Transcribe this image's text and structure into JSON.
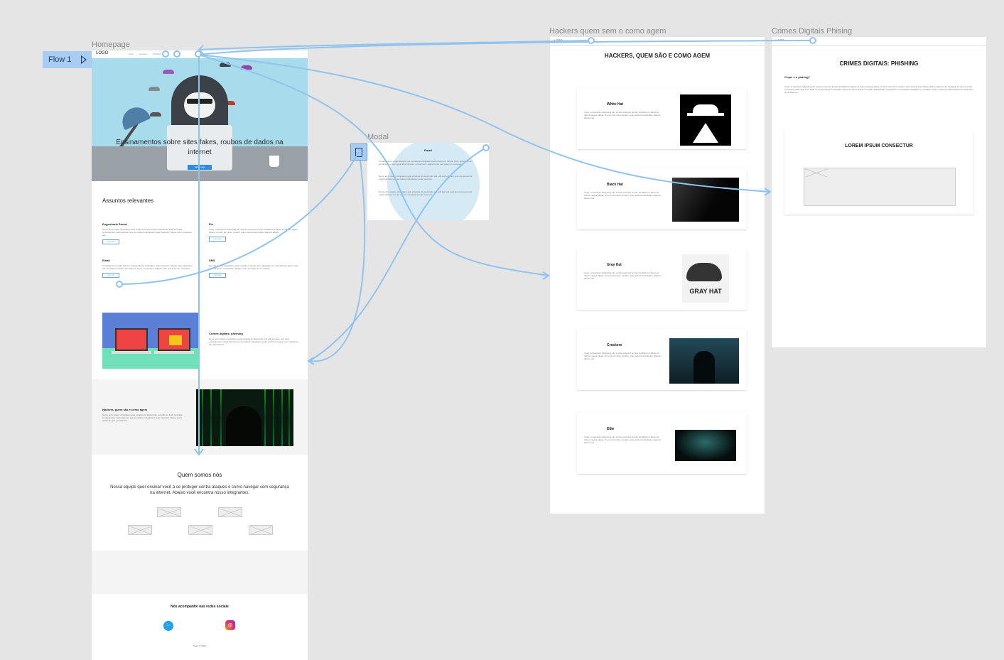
{
  "canvas": {
    "flow_label": "Flow 1",
    "frames": {
      "homepage": "Homepage",
      "modal": "Modal",
      "hackers": "Hackers quem sem o como agem",
      "phishing": "Crimes Digitais Phising"
    }
  },
  "home": {
    "logo": "LOGO",
    "nav": [
      "Início",
      "Hackers",
      "Phishing"
    ],
    "hero_title": "Ensinamentos sobre sites fakes, roubos de dados na internet",
    "hero_button": "Saiba mais",
    "topics_title": "Assuntos relevantes",
    "topics": [
      {
        "title": "Engenharia Social",
        "text": "Nemo enim ipsam voluptatem quia voluptas sit aspernatur aut odit aut fugit, sed quia consequuntur magni dolores eos qui ratione voluptatem sequi nesciunt. Neque porro quisquam est.",
        "button": "Leia mais"
      },
      {
        "title": "Pix",
        "text": "Amet, consectetur adipiscing elit, sed do eiusmod tempor incididunt ut labore et dolore magna aliqua. Ut enim ad minim veniam, quis nostrud exercitation ullamco laboris.",
        "button": "Leia mais"
      },
      {
        "title": "Email",
        "text": "Consequuntur magni dolores eos qui ratione voluptatem sequi nesciunt. Neque porro quisquam est, qui dolorem ipsum quia dolor sit amet, consectetur, adipisci velit, sed quia non numquam.",
        "button": "Leia mais"
      },
      {
        "title": "SMS",
        "text": "Eos qui ratione voluptatem sequi nesciunt. Neque porro quisquam est, qui dolorem ipsum quia dolor sit amet, consectetur, adipisci velit, sed quia non numquam.",
        "button": "Leia mais"
      }
    ],
    "phishing_title": "Crimes digitais: phishing",
    "phishing_text": "Nemo enim ipsam voluptatem quia voluptas sit aspernatur aut odit aut fugit, sed quia consequuntur magni dolores eos qui ratione voluptatem sequi nesciunt. Neque porro quisquam est, qui dolorem.",
    "hackers_title": "Hackers, quem são e como agem",
    "hackers_text": "Nemo enim ipsam voluptatem quia voluptas sit aspernatur aut odit aut fugit, sed quia consequuntur magni dolores eos qui ratione voluptatem sequi nesciunt. Neque porro quisquam est, qui dolorem.",
    "about_title": "Quem somos nós",
    "about_text": "Nossa equipe quer ensinar você a se proteger contra ataques e como navegar com segurança na internet. Abaixo você encontra nosso integrantes.",
    "social_title": "Nós acompanhe nas redes sociais",
    "footer": "Team © 2021"
  },
  "modal": {
    "title": "Email",
    "paragraphs": [
      "Consequuntur magni dolores eos qui ratione voluptatem sequi nesciunt. Neque porro quisquam est, qui dolorem ipsum quia dolor sit amet, consectetur, adipisci velit, sed quia non numquam.",
      "Nemo enim ipsam voluptatem quia voluptas sit aspernatur aut odit aut fugit, sed quia consequuntur magni dolores eos qui ratione voluptatem sequi nesciunt.",
      "Nemo enim ipsam voluptatem quia voluptas sit aspernatur aut odit aut fugit, sed quia consequuntur magni dolores eos qui ratione voluptatem sequi nesciunt."
    ]
  },
  "hackers": {
    "logo": "LOGO",
    "title": "HACKERS, QUEM SÃO E COMO AGEM",
    "cards": [
      {
        "title": "White Hat",
        "text": "Amet, consectetur adipiscing elit, sed do eiusmod tempor incididunt ut labore et dolore magna aliqua. Ut enim ad minim veniam, quis nostrud exercitation ullamco laboris nisi."
      },
      {
        "title": "Black Hat",
        "text": "Amet, consectetur adipiscing elit, sed do eiusmod tempor incididunt ut labore et dolore magna aliqua. Ut enim ad minim veniam, quis nostrud exercitation ullamco laboris nisi."
      },
      {
        "title": "Gray Hat",
        "text": "Amet, consectetur adipiscing elit, sed do eiusmod tempor incididunt ut labore et dolore magna aliqua. Ut enim ad minim veniam, quis nostrud exercitation ullamco laboris nisi."
      },
      {
        "title": "Crackers",
        "text": "Amet, consectetur adipiscing elit, sed do eiusmod tempor incididunt ut labore et dolore magna aliqua. Ut enim ad minim veniam, quis nostrud exercitation ullamco laboris nisi."
      },
      {
        "title": "Elite",
        "text": "Amet, consectetur adipiscing elit, sed do eiusmod tempor incididunt ut labore et dolore magna aliqua. Ut enim ad minim veniam, quis nostrud exercitation ullamco laboris nisi."
      }
    ],
    "gray_hat_caption": "GRAY HAT"
  },
  "phish": {
    "logo": "LOGO",
    "title": "CRIMES DIGITAIS: PHISHING",
    "question": "O que é o pishing?",
    "text": "Amet, consectetur adipiscing elit, sed do eiusmod tempor incididunt ut labore et dolore magna aliqua. Ut enim ad minim veniam, quis nostrud exercitation ullamco laboris nisi ut aliquip ex ea commodo consequat. Duis aute irure dolor in reprehenderit in voluptate velit esse cillum dolore eu fugiat nulla pariatur. Excepteur sint occaecat cupidatat non proident, sunt in culpa qui officia deserunt mollit anim id est laborum.",
    "box_title": "LOREM IPSUM CONSECTUR"
  },
  "colors": {
    "accent": "#2d8de0",
    "flow_line": "#90c4ef",
    "hero_bg": "#a8dced"
  }
}
